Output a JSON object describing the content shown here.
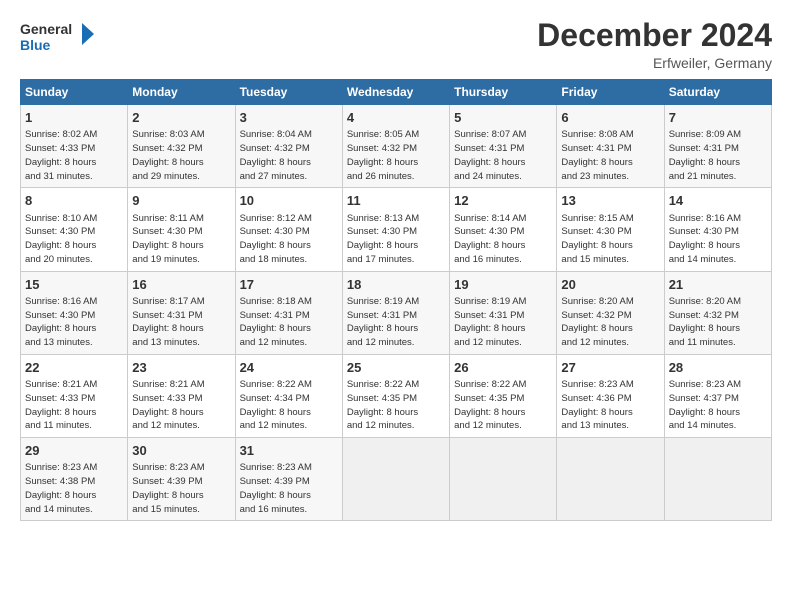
{
  "header": {
    "logo_line1": "General",
    "logo_line2": "Blue",
    "main_title": "December 2024",
    "subtitle": "Erfweiler, Germany"
  },
  "days_of_week": [
    "Sunday",
    "Monday",
    "Tuesday",
    "Wednesday",
    "Thursday",
    "Friday",
    "Saturday"
  ],
  "weeks": [
    [
      {
        "day": "1",
        "info": "Sunrise: 8:02 AM\nSunset: 4:33 PM\nDaylight: 8 hours\nand 31 minutes."
      },
      {
        "day": "2",
        "info": "Sunrise: 8:03 AM\nSunset: 4:32 PM\nDaylight: 8 hours\nand 29 minutes."
      },
      {
        "day": "3",
        "info": "Sunrise: 8:04 AM\nSunset: 4:32 PM\nDaylight: 8 hours\nand 27 minutes."
      },
      {
        "day": "4",
        "info": "Sunrise: 8:05 AM\nSunset: 4:32 PM\nDaylight: 8 hours\nand 26 minutes."
      },
      {
        "day": "5",
        "info": "Sunrise: 8:07 AM\nSunset: 4:31 PM\nDaylight: 8 hours\nand 24 minutes."
      },
      {
        "day": "6",
        "info": "Sunrise: 8:08 AM\nSunset: 4:31 PM\nDaylight: 8 hours\nand 23 minutes."
      },
      {
        "day": "7",
        "info": "Sunrise: 8:09 AM\nSunset: 4:31 PM\nDaylight: 8 hours\nand 21 minutes."
      }
    ],
    [
      {
        "day": "8",
        "info": "Sunrise: 8:10 AM\nSunset: 4:30 PM\nDaylight: 8 hours\nand 20 minutes."
      },
      {
        "day": "9",
        "info": "Sunrise: 8:11 AM\nSunset: 4:30 PM\nDaylight: 8 hours\nand 19 minutes."
      },
      {
        "day": "10",
        "info": "Sunrise: 8:12 AM\nSunset: 4:30 PM\nDaylight: 8 hours\nand 18 minutes."
      },
      {
        "day": "11",
        "info": "Sunrise: 8:13 AM\nSunset: 4:30 PM\nDaylight: 8 hours\nand 17 minutes."
      },
      {
        "day": "12",
        "info": "Sunrise: 8:14 AM\nSunset: 4:30 PM\nDaylight: 8 hours\nand 16 minutes."
      },
      {
        "day": "13",
        "info": "Sunrise: 8:15 AM\nSunset: 4:30 PM\nDaylight: 8 hours\nand 15 minutes."
      },
      {
        "day": "14",
        "info": "Sunrise: 8:16 AM\nSunset: 4:30 PM\nDaylight: 8 hours\nand 14 minutes."
      }
    ],
    [
      {
        "day": "15",
        "info": "Sunrise: 8:16 AM\nSunset: 4:30 PM\nDaylight: 8 hours\nand 13 minutes."
      },
      {
        "day": "16",
        "info": "Sunrise: 8:17 AM\nSunset: 4:31 PM\nDaylight: 8 hours\nand 13 minutes."
      },
      {
        "day": "17",
        "info": "Sunrise: 8:18 AM\nSunset: 4:31 PM\nDaylight: 8 hours\nand 12 minutes."
      },
      {
        "day": "18",
        "info": "Sunrise: 8:19 AM\nSunset: 4:31 PM\nDaylight: 8 hours\nand 12 minutes."
      },
      {
        "day": "19",
        "info": "Sunrise: 8:19 AM\nSunset: 4:31 PM\nDaylight: 8 hours\nand 12 minutes."
      },
      {
        "day": "20",
        "info": "Sunrise: 8:20 AM\nSunset: 4:32 PM\nDaylight: 8 hours\nand 12 minutes."
      },
      {
        "day": "21",
        "info": "Sunrise: 8:20 AM\nSunset: 4:32 PM\nDaylight: 8 hours\nand 11 minutes."
      }
    ],
    [
      {
        "day": "22",
        "info": "Sunrise: 8:21 AM\nSunset: 4:33 PM\nDaylight: 8 hours\nand 11 minutes."
      },
      {
        "day": "23",
        "info": "Sunrise: 8:21 AM\nSunset: 4:33 PM\nDaylight: 8 hours\nand 12 minutes."
      },
      {
        "day": "24",
        "info": "Sunrise: 8:22 AM\nSunset: 4:34 PM\nDaylight: 8 hours\nand 12 minutes."
      },
      {
        "day": "25",
        "info": "Sunrise: 8:22 AM\nSunset: 4:35 PM\nDaylight: 8 hours\nand 12 minutes."
      },
      {
        "day": "26",
        "info": "Sunrise: 8:22 AM\nSunset: 4:35 PM\nDaylight: 8 hours\nand 12 minutes."
      },
      {
        "day": "27",
        "info": "Sunrise: 8:23 AM\nSunset: 4:36 PM\nDaylight: 8 hours\nand 13 minutes."
      },
      {
        "day": "28",
        "info": "Sunrise: 8:23 AM\nSunset: 4:37 PM\nDaylight: 8 hours\nand 14 minutes."
      }
    ],
    [
      {
        "day": "29",
        "info": "Sunrise: 8:23 AM\nSunset: 4:38 PM\nDaylight: 8 hours\nand 14 minutes."
      },
      {
        "day": "30",
        "info": "Sunrise: 8:23 AM\nSunset: 4:39 PM\nDaylight: 8 hours\nand 15 minutes."
      },
      {
        "day": "31",
        "info": "Sunrise: 8:23 AM\nSunset: 4:39 PM\nDaylight: 8 hours\nand 16 minutes."
      },
      {
        "day": "",
        "info": ""
      },
      {
        "day": "",
        "info": ""
      },
      {
        "day": "",
        "info": ""
      },
      {
        "day": "",
        "info": ""
      }
    ]
  ]
}
